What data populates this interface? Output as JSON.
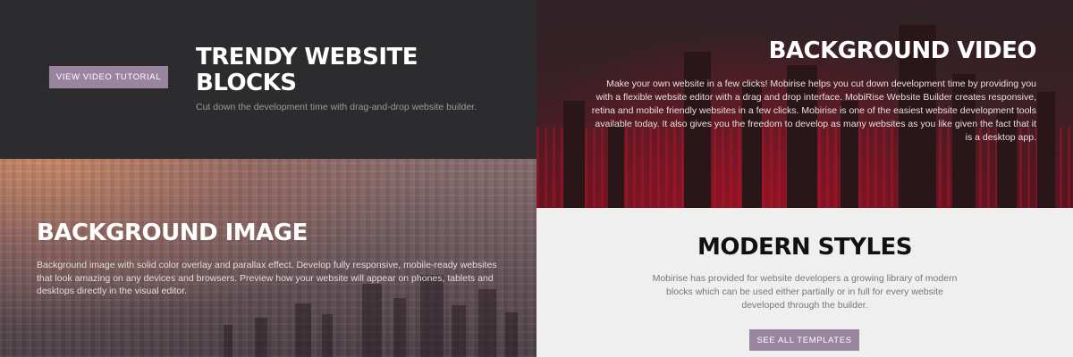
{
  "colors": {
    "button_bg": "#9a85a1",
    "dark_panel_bg": "#2c2b2d",
    "light_panel_bg": "#efefef",
    "video_tint": "#a0142a"
  },
  "trendy": {
    "button_label": "VIEW VIDEO TUTORIAL",
    "title": "TRENDY WEBSITE BLOCKS",
    "subtitle": "Cut down the development time with drag-and-drop website builder."
  },
  "bg_image": {
    "title": "BACKGROUND IMAGE",
    "text": "Background image with solid color overlay and parallax effect. Develop fully responsive, mobile-ready websites that look amazing on any devices and browsers. Preview how your website will appear on phones, tablets and desktops directly in the visual editor."
  },
  "bg_video": {
    "title": "BACKGROUND VIDEO",
    "text": "Make your own website in a few clicks! Mobirise helps you cut down development time by providing you with a flexible website editor with a drag and drop interface. MobiRise Website Builder creates responsive, retina and mobile friendly websites in a few clicks. Mobirise is one of the easiest website development tools available today. It also gives you the freedom to develop as many websites as you like given the fact that it is a desktop app."
  },
  "modern": {
    "title": "MODERN STYLES",
    "text": "Mobirise has provided for website developers a growing library of modern blocks which can be used either partially or in full for every website developed through the builder.",
    "button_label": "SEE ALL TEMPLATES"
  }
}
